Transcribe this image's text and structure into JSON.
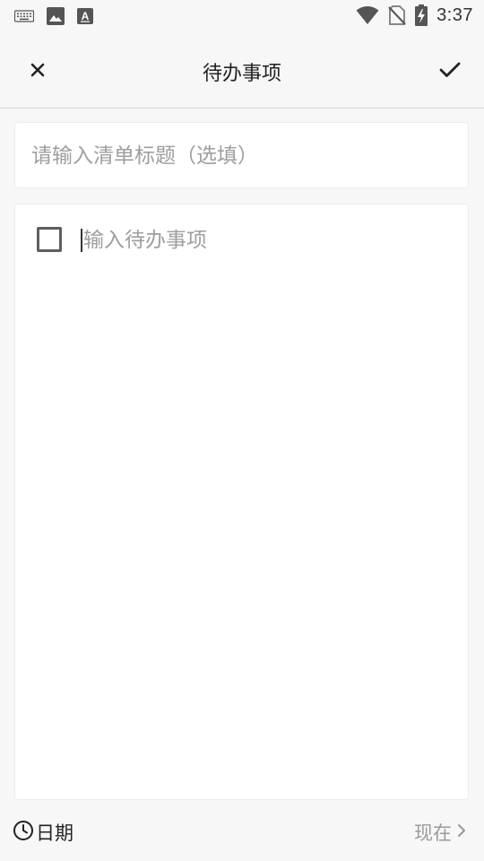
{
  "status_bar": {
    "time": "3:37",
    "left_icons": [
      "keyboard-icon",
      "image-icon",
      "text-a-icon"
    ],
    "right_icons": [
      "wifi-icon",
      "no-sim-icon",
      "battery-charging-icon"
    ]
  },
  "app_bar": {
    "title": "待办事项",
    "close_icon": "close-icon",
    "confirm_icon": "check-icon"
  },
  "title_field": {
    "placeholder": "请输入清单标题（选填）",
    "value": ""
  },
  "todo": {
    "checked": false,
    "placeholder": "输入待办事项",
    "value": ""
  },
  "bottom_bar": {
    "date_label": "日期",
    "date_icon": "clock-icon",
    "time_value": "现在",
    "time_icon": "chevron-right-icon"
  },
  "colors": {
    "background": "#f7f7f7",
    "card": "#ffffff",
    "text_primary": "#222222",
    "text_hint": "#9e9e9e"
  }
}
